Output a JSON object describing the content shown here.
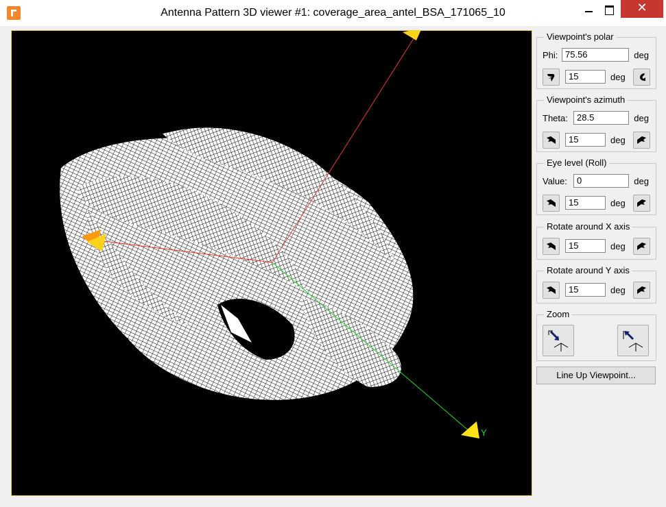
{
  "window": {
    "title": "Antenna Pattern 3D viewer #1: coverage_area_antel_BSA_171065_10",
    "close_glyph": "✕"
  },
  "viewport": {
    "axis_label_y": "Y",
    "axis_colors": {
      "x": "#ff2a1a",
      "y": "#1fdc2a",
      "z": "#e03a3a"
    }
  },
  "panel": {
    "polar": {
      "title": "Viewpoint's polar",
      "label": "Phi:",
      "value": "75.56",
      "unit": "deg",
      "step": "15",
      "step_unit": "deg"
    },
    "azimuth": {
      "title": "Viewpoint's azimuth",
      "label": "Theta:",
      "value": "28.5",
      "unit": "deg",
      "step": "15",
      "step_unit": "deg"
    },
    "eye": {
      "title": "Eye level (Roll)",
      "label": "Value:",
      "value": "0",
      "unit": "deg",
      "step": "15",
      "step_unit": "deg"
    },
    "rotx": {
      "title": "Rotate around X axis",
      "step": "15",
      "step_unit": "deg"
    },
    "roty": {
      "title": "Rotate around Y axis",
      "step": "15",
      "step_unit": "deg"
    },
    "zoom": {
      "title": "Zoom"
    },
    "lineup_label": "Line Up Viewpoint..."
  }
}
